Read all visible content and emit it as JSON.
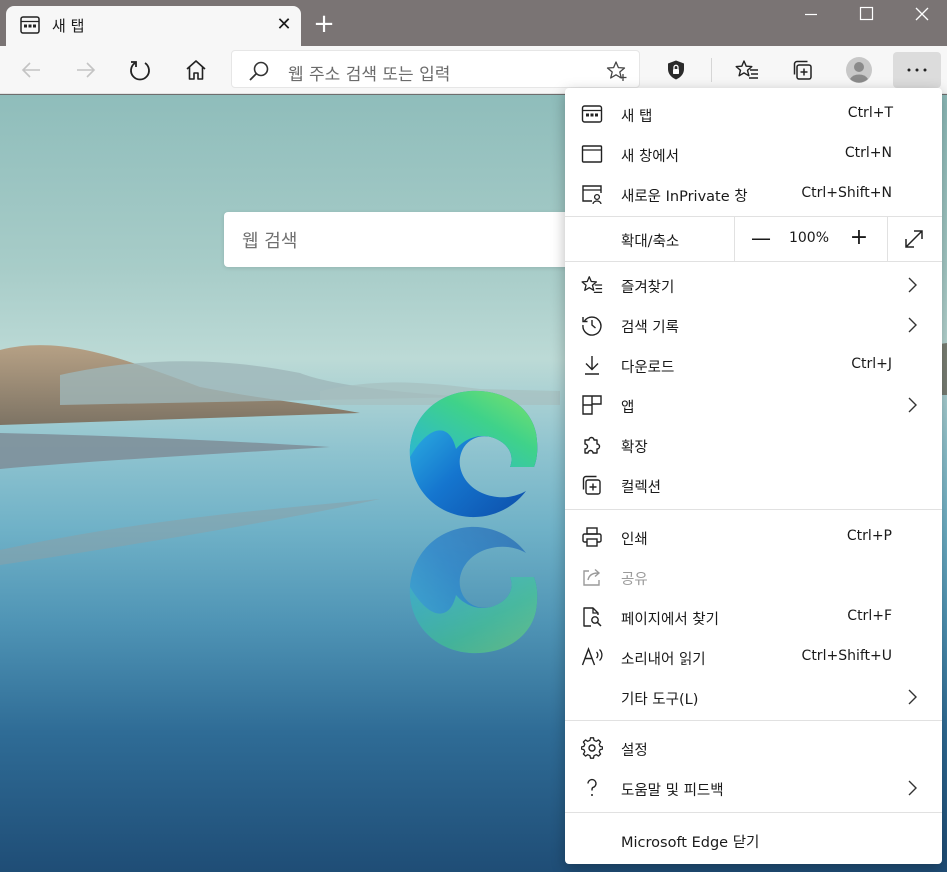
{
  "window": {
    "tab_title": "새 탭",
    "close_tab": "✕",
    "new_tab": "+"
  },
  "toolbar": {
    "address_placeholder": "웹 주소 검색 또는 입력"
  },
  "page": {
    "search_placeholder": "웹 검색"
  },
  "menu": {
    "items_top": [
      {
        "label": "새 탭",
        "shortcut": "Ctrl+T"
      },
      {
        "label": "새 창에서",
        "shortcut": "Ctrl+N"
      },
      {
        "label": "새로운 InPrivate 창",
        "shortcut": "Ctrl+Shift+N"
      }
    ],
    "zoom": {
      "label": "확대/축소",
      "minus": "—",
      "value": "100%",
      "plus": "+"
    },
    "items_mid": [
      {
        "label": "즐겨찾기"
      },
      {
        "label": "검색 기록"
      },
      {
        "label": "다운로드",
        "shortcut": "Ctrl+J"
      },
      {
        "label": "앱"
      },
      {
        "label": "확장"
      },
      {
        "label": "컬렉션"
      }
    ],
    "items_tools": [
      {
        "label": "인쇄",
        "shortcut": "Ctrl+P"
      },
      {
        "label": "공유"
      },
      {
        "label": "페이지에서 찾기",
        "shortcut": "Ctrl+F"
      },
      {
        "label": "소리내어 읽기",
        "shortcut": "Ctrl+Shift+U"
      },
      {
        "label": "기타 도구(L)"
      }
    ],
    "items_bottom": [
      {
        "label": "설정"
      },
      {
        "label": "도움말 및 피드백"
      }
    ],
    "close": {
      "label": "Microsoft Edge 닫기"
    }
  }
}
